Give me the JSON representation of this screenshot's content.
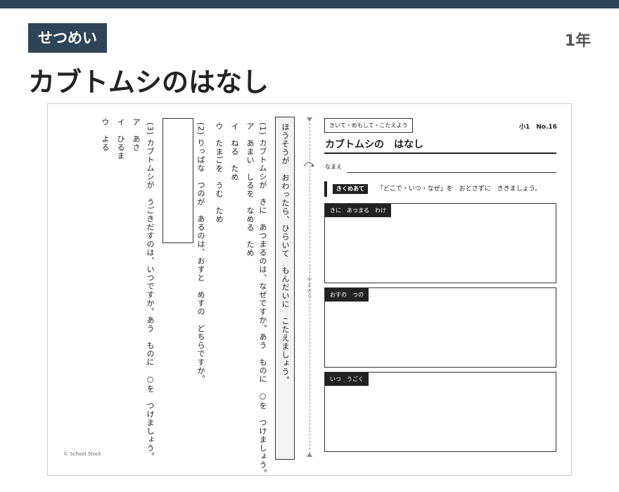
{
  "header": {
    "badge": "せつめい",
    "grade": "1年",
    "title": "カブトムシのはなし"
  },
  "sheet": {
    "instruction": "ほうそうが　おわったら、ひらいて　もんだいに　こたえましょう。",
    "q1_lines": [
      "(1) カブトムシが　きに　あつまるのは、なぜですか。あう　ものに　○を　つけましょう。",
      "ア　あまい　しるを　なめる　ため",
      "イ　ねる　ため",
      "ウ　たまごを　うむ　ため"
    ],
    "q2_line": "(2) りっぱな　つのが　あるのは、おすと　めすの　どちらですか。",
    "q3_lines": [
      "(3) カブトムシが　うごきだすのは、いつですか。あう　ものに　○を　つけましょう。",
      "ア　あさ",
      "イ　ひるま",
      "ウ　よる"
    ],
    "fold_label": "やまおり",
    "copyright": "© School Stock",
    "task_tag": "きいて・めもして・こたえよう",
    "sheet_number": "小1　No.16",
    "sheet_title": "カブトムシの　はなし",
    "name_label": "なまえ",
    "goal_badge": "きくめあて",
    "goal_text": "「どこで・いつ・なぜ」を　おとさずに　ききましょう。",
    "memo_boxes": [
      {
        "label": "きに　あつまる　わけ"
      },
      {
        "label": "おすの　つの"
      },
      {
        "label": "いつ　うごく"
      }
    ]
  },
  "colors": {
    "accent": "#2e4457",
    "ink": "#222222"
  }
}
